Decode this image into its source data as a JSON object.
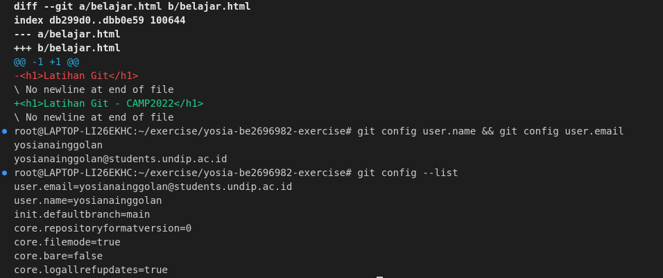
{
  "terminal": {
    "diff_header_1": "diff --git a/belajar.html b/belajar.html",
    "diff_header_2": "index db299d0..dbb0e59 100644",
    "diff_header_3": "--- a/belajar.html",
    "diff_header_4": "+++ b/belajar.html",
    "hunk": "@@ -1 +1 @@",
    "removed_line": "-<h1>Latihan Git</h1>",
    "no_newline_1": "\\ No newline at end of file",
    "added_line": "+<h1>Latihan Git - CAMP2022</h1>",
    "no_newline_2": "\\ No newline at end of file",
    "cmd1": "root@LAPTOP-LI26EKHC:~/exercise/yosia-be2696982-exercise# git config user.name && git config user.email",
    "out1_name": "yosianainggolan",
    "out1_email": "yosianainggolan@students.undip.ac.id",
    "cmd2": "root@LAPTOP-LI26EKHC:~/exercise/yosia-be2696982-exercise# git config --list",
    "config_list": [
      "user.email=yosianainggolan@students.undip.ac.id",
      "user.name=yosianainggolan",
      "init.defaultbranch=main",
      "core.repositoryformatversion=0",
      "core.filemode=true",
      "core.bare=false",
      "core.logallrefupdates=true"
    ],
    "marker_color": "#3794ff",
    "colors": {
      "background": "#1e1e1e",
      "hunk": "#2fa8d8",
      "removed": "#f14c4c",
      "added": "#23d18b"
    }
  }
}
